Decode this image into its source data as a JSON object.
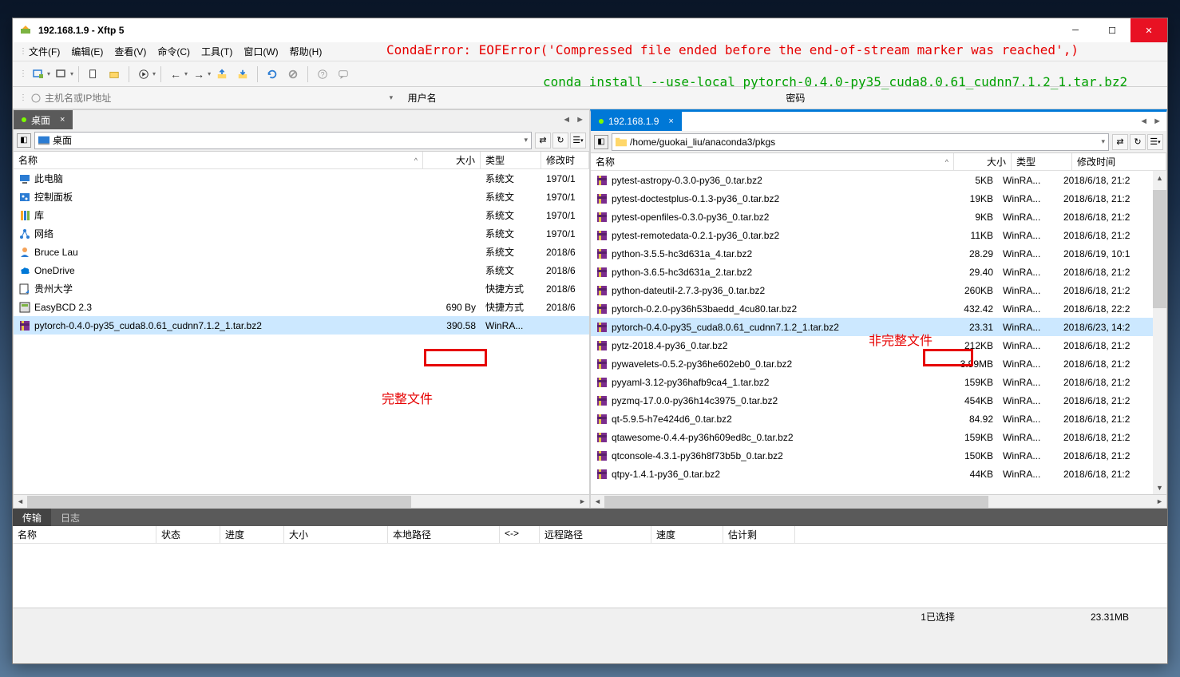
{
  "window": {
    "title": "192.168.1.9   - Xftp 5"
  },
  "menu": [
    "文件(F)",
    "编辑(E)",
    "查看(V)",
    "命令(C)",
    "工具(T)",
    "窗口(W)",
    "帮助(H)"
  ],
  "addressbar": {
    "placeholder": "主机名或IP地址",
    "user_label": "用户名",
    "pass_label": "密码"
  },
  "left_pane": {
    "tab": "桌面",
    "path": "桌面",
    "columns": {
      "name": "名称",
      "size": "大小",
      "type": "类型",
      "date": "修改时"
    },
    "rows": [
      {
        "icon": "pc",
        "name": "此电脑",
        "size": "",
        "type": "系统文",
        "date": "1970/1"
      },
      {
        "icon": "cp",
        "name": "控制面板",
        "size": "",
        "type": "系统文",
        "date": "1970/1"
      },
      {
        "icon": "lib",
        "name": "库",
        "size": "",
        "type": "系统文",
        "date": "1970/1"
      },
      {
        "icon": "net",
        "name": "网络",
        "size": "",
        "type": "系统文",
        "date": "1970/1"
      },
      {
        "icon": "user",
        "name": "Bruce Lau",
        "size": "",
        "type": "系统文",
        "date": "2018/6"
      },
      {
        "icon": "od",
        "name": "OneDrive",
        "size": "",
        "type": "系统文",
        "date": "2018/6"
      },
      {
        "icon": "link",
        "name": "贵州大学",
        "size": "",
        "type": "快捷方式",
        "date": "2018/6"
      },
      {
        "icon": "app",
        "name": "EasyBCD 2.3",
        "size": "690 By",
        "type": "快捷方式",
        "date": "2018/6"
      },
      {
        "icon": "rar",
        "name": "pytorch-0.4.0-py35_cuda8.0.61_cudnn7.1.2_1.tar.bz2",
        "size": "390.58",
        "type": "WinRA...",
        "date": "",
        "selected": true
      }
    ]
  },
  "right_pane": {
    "tab": "192.168.1.9",
    "path": "/home/guokai_liu/anaconda3/pkgs",
    "columns": {
      "name": "名称",
      "size": "大小",
      "type": "类型",
      "date": "修改时间"
    },
    "rows": [
      {
        "name": "pytest-astropy-0.3.0-py36_0.tar.bz2",
        "size": "5KB",
        "type": "WinRA...",
        "date": "2018/6/18, 21:2"
      },
      {
        "name": "pytest-doctestplus-0.1.3-py36_0.tar.bz2",
        "size": "19KB",
        "type": "WinRA...",
        "date": "2018/6/18, 21:2"
      },
      {
        "name": "pytest-openfiles-0.3.0-py36_0.tar.bz2",
        "size": "9KB",
        "type": "WinRA...",
        "date": "2018/6/18, 21:2"
      },
      {
        "name": "pytest-remotedata-0.2.1-py36_0.tar.bz2",
        "size": "11KB",
        "type": "WinRA...",
        "date": "2018/6/18, 21:2"
      },
      {
        "name": "python-3.5.5-hc3d631a_4.tar.bz2",
        "size": "28.29",
        "type": "WinRA...",
        "date": "2018/6/19, 10:1"
      },
      {
        "name": "python-3.6.5-hc3d631a_2.tar.bz2",
        "size": "29.40",
        "type": "WinRA...",
        "date": "2018/6/18, 21:2"
      },
      {
        "name": "python-dateutil-2.7.3-py36_0.tar.bz2",
        "size": "260KB",
        "type": "WinRA...",
        "date": "2018/6/18, 21:2"
      },
      {
        "name": "pytorch-0.2.0-py36h53baedd_4cu80.tar.bz2",
        "size": "432.42",
        "type": "WinRA...",
        "date": "2018/6/18, 22:2"
      },
      {
        "name": "pytorch-0.4.0-py35_cuda8.0.61_cudnn7.1.2_1.tar.bz2",
        "size": "23.31",
        "type": "WinRA...",
        "date": "2018/6/23, 14:2",
        "selected": true
      },
      {
        "name": "pytz-2018.4-py36_0.tar.bz2",
        "size": "212KB",
        "type": "WinRA...",
        "date": "2018/6/18, 21:2"
      },
      {
        "name": "pywavelets-0.5.2-py36he602eb0_0.tar.bz2",
        "size": "3.99MB",
        "type": "WinRA...",
        "date": "2018/6/18, 21:2"
      },
      {
        "name": "pyyaml-3.12-py36hafb9ca4_1.tar.bz2",
        "size": "159KB",
        "type": "WinRA...",
        "date": "2018/6/18, 21:2"
      },
      {
        "name": "pyzmq-17.0.0-py36h14c3975_0.tar.bz2",
        "size": "454KB",
        "type": "WinRA...",
        "date": "2018/6/18, 21:2"
      },
      {
        "name": "qt-5.9.5-h7e424d6_0.tar.bz2",
        "size": "84.92",
        "type": "WinRA...",
        "date": "2018/6/18, 21:2"
      },
      {
        "name": "qtawesome-0.4.4-py36h609ed8c_0.tar.bz2",
        "size": "159KB",
        "type": "WinRA...",
        "date": "2018/6/18, 21:2"
      },
      {
        "name": "qtconsole-4.3.1-py36h8f73b5b_0.tar.bz2",
        "size": "150KB",
        "type": "WinRA...",
        "date": "2018/6/18, 21:2"
      },
      {
        "name": "qtpy-1.4.1-py36_0.tar.bz2",
        "size": "44KB",
        "type": "WinRA...",
        "date": "2018/6/18, 21:2"
      }
    ]
  },
  "bottom": {
    "tabs": [
      "传输",
      "日志"
    ],
    "columns": {
      "name": "名称",
      "status": "状态",
      "progress": "进度",
      "size": "大小",
      "local": "本地路径",
      "arrow": "<->",
      "remote": "远程路径",
      "speed": "速度",
      "remain": "估计剩"
    }
  },
  "status": {
    "selected": "1已选择",
    "size": "23.31MB"
  },
  "annotations": {
    "error": "CondaError: EOFError('Compressed file ended before the end-of-stream marker was reached',)",
    "command": "conda install --use-local pytorch-0.4.0-py35_cuda8.0.61_cudnn7.1.2_1.tar.bz2",
    "complete": "完整文件",
    "incomplete": "非完整文件"
  }
}
